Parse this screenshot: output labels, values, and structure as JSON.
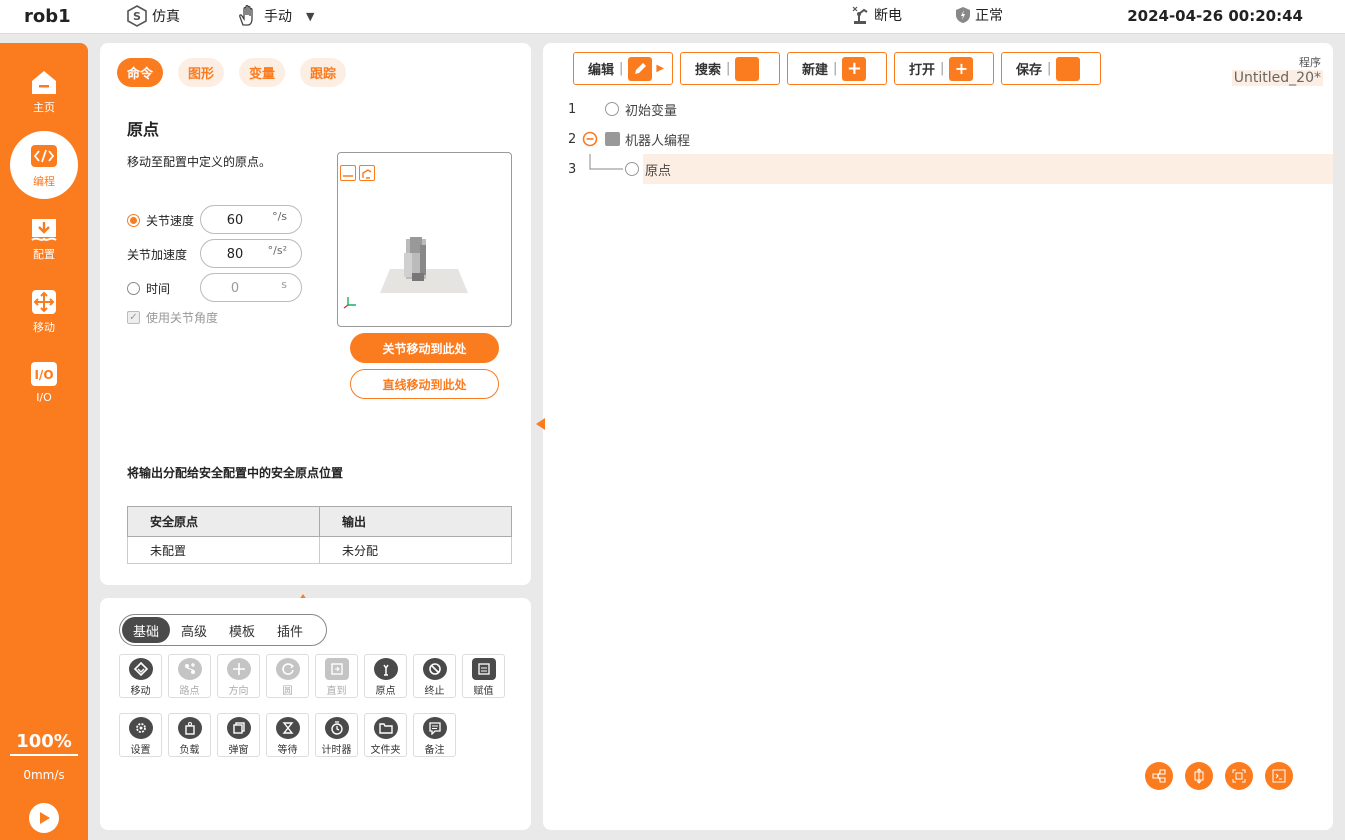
{
  "topbar": {
    "robot_name": "rob1",
    "mode_sim": "仿真",
    "mode_manual": "手动",
    "power_status": "断电",
    "safety_status": "正常",
    "datetime": "2024-04-26 00:20:44"
  },
  "sidebar": {
    "items": [
      {
        "label": "主页",
        "icon": "home-icon"
      },
      {
        "label": "编程",
        "icon": "code-icon",
        "active": true
      },
      {
        "label": "配置",
        "icon": "download-icon"
      },
      {
        "label": "移动",
        "icon": "move-icon"
      },
      {
        "label": "I/O",
        "icon": "io-icon"
      }
    ],
    "speed_percent": "100%",
    "speed_value": "0mm/s",
    "help": [
      "?",
      "?",
      "?",
      "?"
    ]
  },
  "command_panel": {
    "tabs": [
      "命令",
      "图形",
      "变量",
      "跟踪"
    ],
    "title": "原点",
    "description": "移动至配置中定义的原点。",
    "params": [
      {
        "label": "关节速度",
        "value": "60",
        "unit": "°/s",
        "radio": true,
        "selected": true
      },
      {
        "label": "关节加速度",
        "value": "80",
        "unit": "°/s²",
        "radio": false
      },
      {
        "label": "时间",
        "value": "0",
        "unit": "s",
        "radio": true,
        "selected": false
      }
    ],
    "use_joint_angle": "使用关节角度",
    "btn_joint_move": "关节移动到此处",
    "btn_linear_move": "直线移动到此处",
    "safety_title": "将输出分配给安全配置中的安全原点位置",
    "safety_table": {
      "headers": [
        "安全原点",
        "输出"
      ],
      "rows": [
        [
          "未配置",
          "未分配"
        ]
      ]
    }
  },
  "toolbox": {
    "tabs": [
      "基础",
      "高级",
      "模板",
      "插件"
    ],
    "tools": [
      {
        "label": "移动",
        "icon": "move-tool-icon",
        "enabled": true
      },
      {
        "label": "路点",
        "icon": "waypoint-icon",
        "enabled": false
      },
      {
        "label": "方向",
        "icon": "direction-icon",
        "enabled": false
      },
      {
        "label": "圆",
        "icon": "circle-icon",
        "enabled": false
      },
      {
        "label": "直到",
        "icon": "until-icon",
        "enabled": false
      },
      {
        "label": "原点",
        "icon": "home-point-icon",
        "enabled": true
      },
      {
        "label": "终止",
        "icon": "stop-icon",
        "enabled": true
      },
      {
        "label": "赋值",
        "icon": "assign-icon",
        "enabled": true
      },
      {
        "label": "设置",
        "icon": "settings-icon",
        "enabled": true
      },
      {
        "label": "负载",
        "icon": "payload-icon",
        "enabled": true
      },
      {
        "label": "弹窗",
        "icon": "popup-icon",
        "enabled": true
      },
      {
        "label": "等待",
        "icon": "hourglass-icon",
        "enabled": true
      },
      {
        "label": "计时器",
        "icon": "timer-icon",
        "enabled": true
      },
      {
        "label": "文件夹",
        "icon": "folder-icon",
        "enabled": true
      },
      {
        "label": "备注",
        "icon": "comment-icon",
        "enabled": true
      }
    ]
  },
  "program_panel": {
    "buttons": [
      "编辑",
      "搜索",
      "新建",
      "打开",
      "保存"
    ],
    "program_label": "程序",
    "program_name": "Untitled_20*",
    "lines": [
      {
        "num": "1",
        "text": "初始变量"
      },
      {
        "num": "2",
        "text": "机器人编程"
      },
      {
        "num": "3",
        "text": "原点"
      }
    ]
  },
  "colors": {
    "accent": "#fb7b1f",
    "accent_light": "#fdeee3"
  }
}
